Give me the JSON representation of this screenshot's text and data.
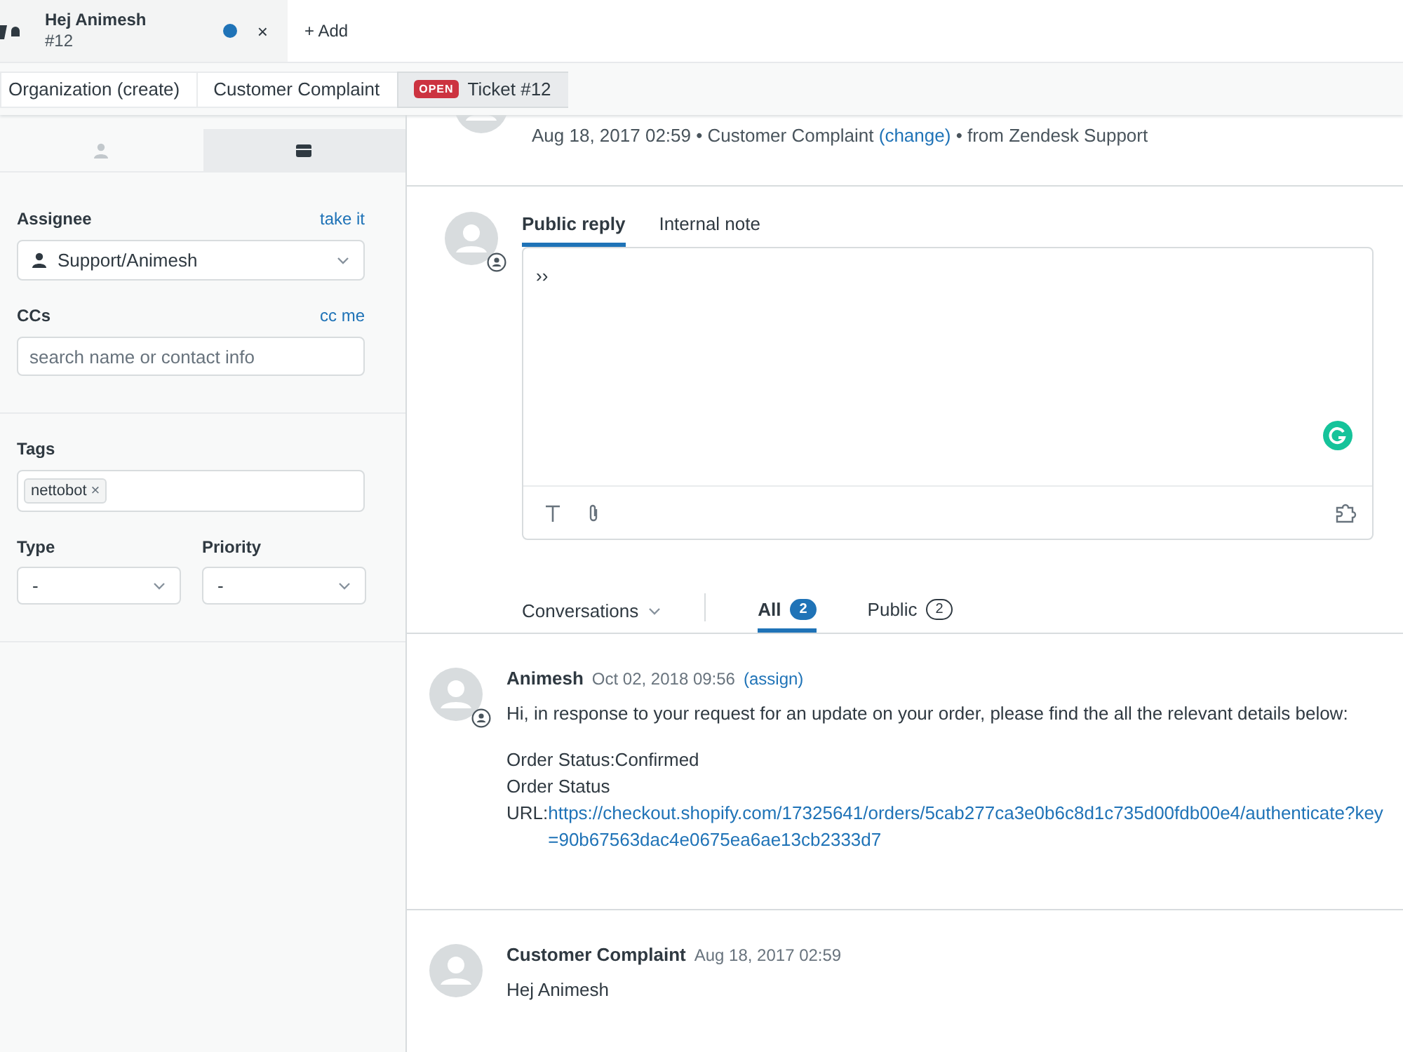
{
  "top_tab": {
    "title": "Hej Animesh",
    "subtitle": "#12",
    "unsaved": true,
    "close": "×"
  },
  "add_tab": {
    "icon": "+",
    "label": "Add"
  },
  "breadcrumbs": [
    {
      "label": "Organization (create)",
      "selected": false
    },
    {
      "label": "Customer Complaint",
      "selected": false
    },
    {
      "badge": "OPEN",
      "label": "Ticket #12",
      "selected": true
    }
  ],
  "sidebar": {
    "tabs": [
      {
        "kind": "person",
        "selected": false
      },
      {
        "kind": "card",
        "selected": true
      }
    ],
    "assignee": {
      "label": "Assignee",
      "link": "take it",
      "value": "Support/Animesh"
    },
    "ccs": {
      "label": "CCs",
      "link": "cc me",
      "placeholder": "search name or contact info"
    },
    "tags": {
      "label": "Tags",
      "items": [
        {
          "label": "nettobot",
          "remove": "×"
        }
      ]
    },
    "type": {
      "label": "Type",
      "value": "-"
    },
    "priority": {
      "label": "Priority",
      "value": "-"
    }
  },
  "ticket_header": {
    "before": "Aug 18, 2017 02:59 • Customer Complaint",
    "link": "(change)",
    "after": "• from Zendesk Support"
  },
  "composer": {
    "tabs": [
      {
        "label": "Public reply",
        "selected": true
      },
      {
        "label": "Internal note",
        "selected": false
      }
    ],
    "value": "››"
  },
  "conversation_filter": {
    "dropdown": "Conversations",
    "tabs": [
      {
        "label": "All",
        "count": "2",
        "selected": true
      },
      {
        "label": "Public",
        "count": "2",
        "selected": false
      }
    ]
  },
  "messages": [
    {
      "author": "Animesh",
      "time": "Oct 02, 2018 09:56",
      "action": "(assign)",
      "agent": true,
      "paragraphs": [
        [
          {
            "kind": "text",
            "text": "Hi, in response to your request for an update on your order, please find the all the relevant details below:"
          }
        ],
        [
          {
            "kind": "text",
            "text": "Order Status:Confirmed"
          },
          {
            "kind": "text",
            "text": "Order Status"
          },
          {
            "kind": "link",
            "prefix": "URL:",
            "link": "https://checkout.shopify.com/17325641/orders/5cab277ca3e0b6c8d1c735d00fdb00e4/authenticate?key=90b67563dac4e0675ea6ae13cb2333d7"
          }
        ]
      ]
    },
    {
      "author": "Customer Complaint",
      "time": "Aug 18, 2017 02:59",
      "agent": false,
      "paragraphs": [
        [
          {
            "kind": "text",
            "text": "Hej Animesh"
          }
        ]
      ]
    }
  ]
}
